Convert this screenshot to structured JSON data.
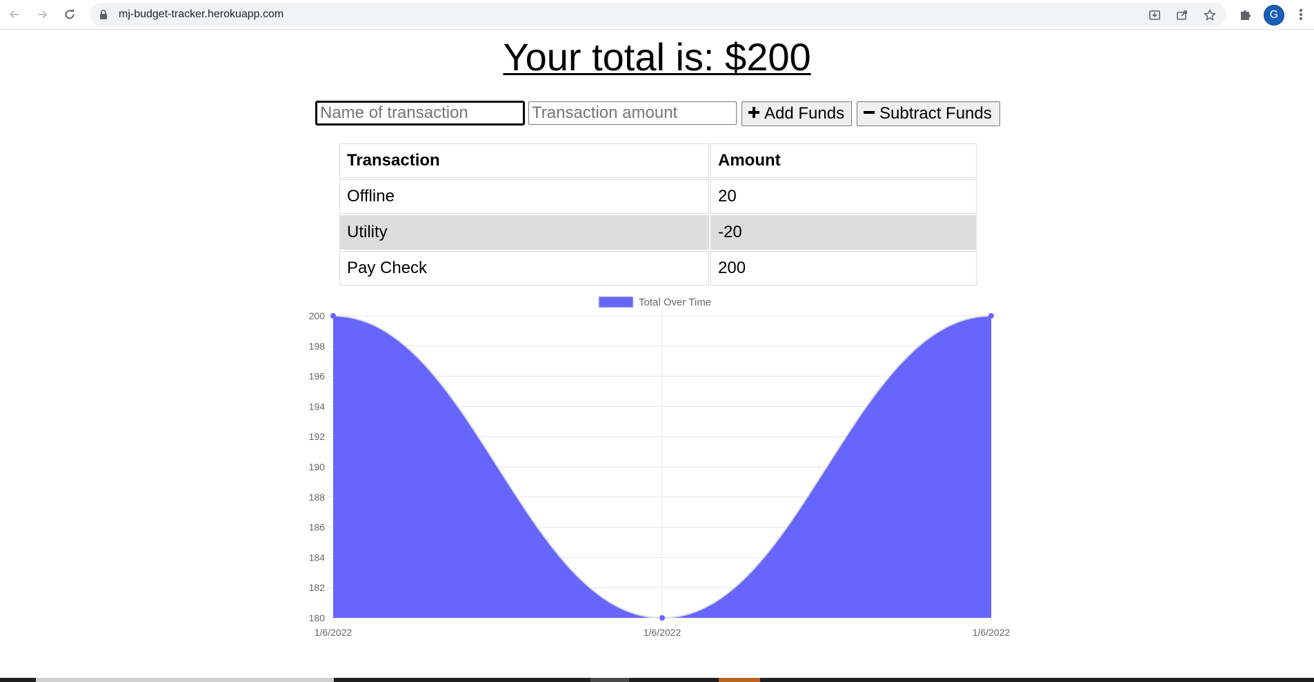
{
  "browser": {
    "url": "mj-budget-tracker.herokuapp.com",
    "profile_initial": "G",
    "icons": {
      "back": "back-arrow-icon",
      "forward": "forward-arrow-icon",
      "reload": "reload-icon",
      "lock": "lock-icon",
      "install": "install-icon",
      "share": "share-icon",
      "bookmark": "star-icon",
      "extensions": "puzzle-icon",
      "menu": "kebab-menu-icon"
    }
  },
  "header": {
    "total_text": "Your total is: $200"
  },
  "form": {
    "name_placeholder": "Name of transaction",
    "amount_placeholder": "Transaction amount",
    "add_label": "Add Funds",
    "subtract_label": "Subtract Funds"
  },
  "table": {
    "headers": [
      "Transaction",
      "Amount"
    ],
    "rows": [
      {
        "name": "Offline",
        "amount": "20"
      },
      {
        "name": "Utility",
        "amount": "-20"
      },
      {
        "name": "Pay Check",
        "amount": "200"
      }
    ]
  },
  "chart_data": {
    "type": "area",
    "legend": "Total Over Time",
    "legend_position": "top-center",
    "x": [
      "1/6/2022",
      "1/6/2022",
      "1/6/2022"
    ],
    "series": [
      {
        "name": "Total Over Time",
        "values": [
          200,
          180,
          200
        ]
      }
    ],
    "ylim": [
      180,
      200
    ],
    "yticks": [
      180,
      182,
      184,
      186,
      188,
      190,
      192,
      194,
      196,
      198,
      200
    ],
    "grid": true,
    "fill_color": "#6666ff",
    "line_color": "#dddddd",
    "grid_color": "#e5e5e5",
    "text_color": "#666666"
  },
  "colors": {
    "alt_row": "#dddddd",
    "avatar": "#1a5fb4"
  }
}
